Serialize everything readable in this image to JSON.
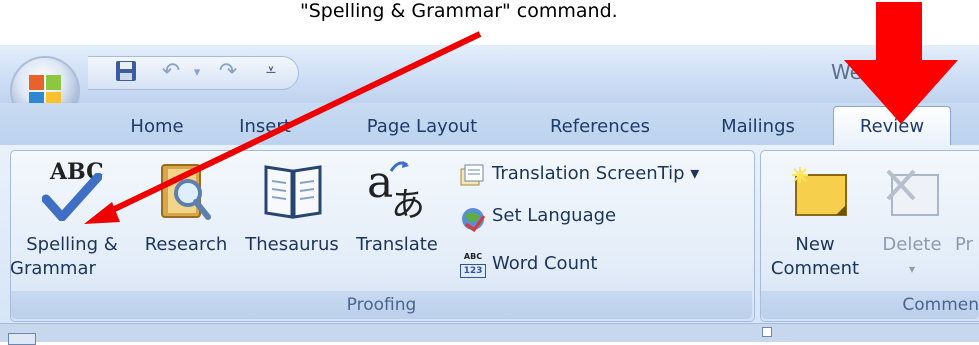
{
  "caption": "\"Spelling & Grammar\" command.",
  "window": {
    "title": "We     w tha"
  },
  "quick_access": {
    "save_icon": "save-icon",
    "undo_icon": "undo-icon",
    "redo_icon": "redo-icon",
    "customize_icon": "customize-qat-icon"
  },
  "tabs": [
    {
      "label": "Home"
    },
    {
      "label": "Insert"
    },
    {
      "label": "Page Layout"
    },
    {
      "label": "References"
    },
    {
      "label": "Mailings"
    },
    {
      "label": "Review",
      "active": true
    }
  ],
  "proofing": {
    "group_label": "Proofing",
    "spelling": {
      "line1": "Spelling &",
      "line2": "Grammar",
      "icon_text": "ABC"
    },
    "research": {
      "label": "Research"
    },
    "thesaurus": {
      "label": "Thesaurus"
    },
    "translate": {
      "label": "Translate",
      "glyph_a": "a",
      "glyph_jp": "あ"
    },
    "translation_screentip": {
      "label": "Translation ScreenTip ▾"
    },
    "set_language": {
      "label": "Set Language"
    },
    "word_count": {
      "label": "Word Count",
      "icon_top": "ABC",
      "icon_bottom": "123"
    }
  },
  "comments": {
    "group_label": "Commen",
    "new_comment": {
      "line1": "New",
      "line2": "Comment"
    },
    "delete": {
      "label": "Delete",
      "arrow": "▾"
    },
    "previous": {
      "label": "Pr"
    }
  },
  "annotation_colors": {
    "arrow": "#ee0000",
    "big_arrow": "#ff0000"
  }
}
